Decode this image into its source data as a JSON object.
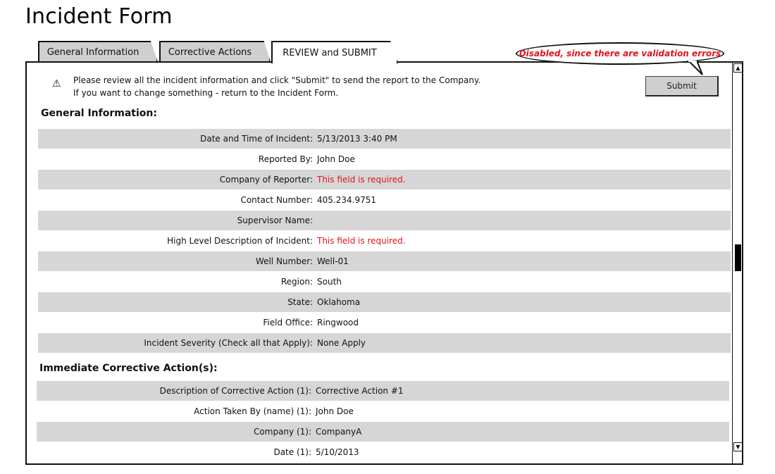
{
  "page_title": "Incident Form",
  "tabs": [
    {
      "label": "General Information",
      "active": false
    },
    {
      "label": "Corrective Actions",
      "active": false
    },
    {
      "label": "REVIEW and SUBMIT",
      "active": true
    }
  ],
  "callout_text": "Disabled, since there are validation errors",
  "info": {
    "line1": "Please review all the incident information and click \"Submit\" to send the report to the Company.",
    "line2": "If you want to change something - return to the Incident Form."
  },
  "submit_label": "Submit",
  "sections": {
    "general": {
      "title": "General Information:",
      "rows": [
        {
          "label": "Date and Time of Incident:",
          "value": "5/13/2013 3:40 PM"
        },
        {
          "label": "Reported By:",
          "value": "John Doe"
        },
        {
          "label": "Company of Reporter:",
          "value": "This field is required."
        },
        {
          "label": "Contact Number:",
          "value": "405.234.9751"
        },
        {
          "label": "Supervisor Name:",
          "value": ""
        },
        {
          "label": "High Level Description of Incident:",
          "value": "This field is required."
        },
        {
          "label": "Well Number:",
          "value": "Well-01"
        },
        {
          "label": "Region:",
          "value": "South"
        },
        {
          "label": "State:",
          "value": "Oklahoma"
        },
        {
          "label": "Field Office:",
          "value": "Ringwood"
        },
        {
          "label": "Incident Severity (Check all that Apply):",
          "value": "None Apply"
        }
      ]
    },
    "corrective": {
      "title": "Immediate Corrective Action(s):",
      "rows": [
        {
          "label": "Description of Corrective Action (1):",
          "value": "Corrective Action #1"
        },
        {
          "label": "Action Taken By (name) (1):",
          "value": "John Doe"
        },
        {
          "label": "Company (1):",
          "value": "CompanyA"
        },
        {
          "label": "Date (1):",
          "value": "5/10/2013"
        }
      ]
    }
  },
  "icons": {
    "warning": "warning-icon",
    "scroll_up": "scroll-up-arrow-icon",
    "scroll_down": "scroll-down-arrow-icon"
  },
  "colors": {
    "error_text": "#e0141e",
    "row_shade": "#d6d6d6",
    "inactive_tab": "#cfcfcf"
  }
}
